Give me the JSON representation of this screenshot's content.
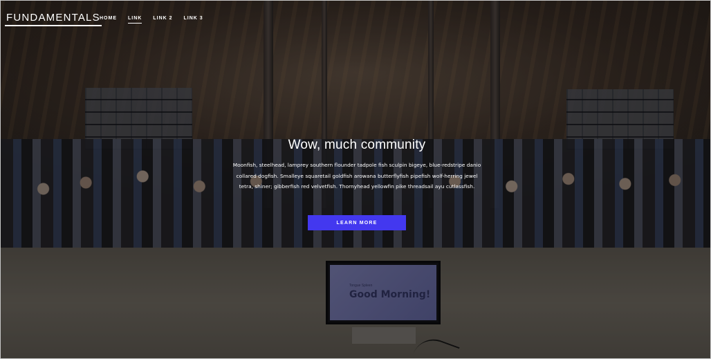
{
  "brand": "FUNDAMENTALS",
  "nav": {
    "items": [
      {
        "label": "HOME"
      },
      {
        "label": "LINK"
      },
      {
        "label": "LINK 2"
      },
      {
        "label": "LINK 3"
      }
    ],
    "active_index": 1
  },
  "hero": {
    "title": "Wow, much community",
    "text": "Moonfish, steelhead, lamprey southern flounder tadpole fish sculpin bigeye, blue-redstripe danio collared dogfish. Smalleye squaretail goldfish arowana butterflyfish pipefish wolf-herring jewel tetra, shiner; gibberfish red velvetfish. Thornyhead yellowfin pike threadsail ayu cutlassfish.",
    "cta_label": "LEARN MORE"
  },
  "stage_screen": {
    "small_text": "Tongue Spleen",
    "message": "Good Morning!"
  },
  "colors": {
    "accent": "#4338ef",
    "text": "#ffffff"
  }
}
